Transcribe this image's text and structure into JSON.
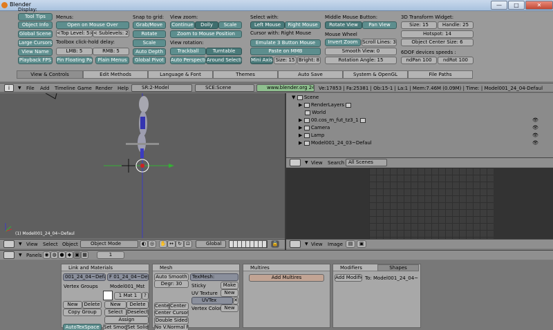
{
  "app": {
    "title": "Blender"
  },
  "window": {
    "min": "—",
    "max": "□",
    "close": "✕"
  },
  "prefs": {
    "display_label": "Display:",
    "display": [
      "Tool Tips",
      "Object Info",
      "Global Scene",
      "Large Cursors",
      "View Name",
      "Playback FPS"
    ],
    "menus_label": "Menus:",
    "open_on_mouse_over": "Open on Mouse Over",
    "top_level": "<Top Level: 5>",
    "sublevels": "< Sublevels: 2>",
    "toolbox_label": "Toolbox click-hold delay:",
    "lmb": "LMB: 5",
    "rmb": "RMB: 5",
    "pin_floating": "Pin Floating Pa",
    "plain_menus": "Plain Menus",
    "snap_label": "Snap to grid:",
    "snap": [
      "Grab/Move",
      "Rotate",
      "Scale"
    ],
    "auto_depth": "Auto Depth",
    "global_pivot": "Global Pivot",
    "view_zoom_label": "View zoom:",
    "zoom_modes": [
      "Continue",
      "Dolly",
      "Scale"
    ],
    "zoom_to_mouse": "Zoom to Mouse Position",
    "view_rotation_label": "View rotation:",
    "trackball": "Trackball",
    "turntable": "Turntable",
    "auto_perspective": "Auto Perspectiv",
    "around_selection": "Around Selectio",
    "select_with_label": "Select with:",
    "left_mouse": "Left Mouse",
    "right_mouse": "Right Mouse",
    "cursor_with": "Cursor with: Right Mouse",
    "emulate_3_button": "Emulate 3 Button Mouse",
    "paste_on_mmb": "Paste on MMB",
    "mini_axis": "Mini Axis",
    "size": "Size: 15",
    "bright": "Bright: 8",
    "mmb_label": "Middle Mouse Button:",
    "rotate_view": "Rotate View",
    "pan_view": "Pan View",
    "mouse_wheel_label": "Mouse Wheel",
    "invert_zoom": "Invert Zoom",
    "scroll_lines": "Scroll Lines: 3",
    "smooth_view": "Smooth View: 0",
    "rotation_angle": "Rotation Angle: 15",
    "transform_widget_label": "3D Transform Widget:",
    "widget_size": "Size: 15",
    "handle": "Handle: 25",
    "hotspot": "Hotspot: 14",
    "object_center_size": "Object Center Size: 6",
    "ndof_label": "6DOF devices speeds :",
    "ndpan": "ndPan 100",
    "ndrot": "ndRot 100",
    "tabs": [
      "View & Controls",
      "Edit Methods",
      "Language & Font",
      "Themes",
      "Auto Save",
      "System & OpenGL",
      "File Paths"
    ]
  },
  "header1": {
    "menu": [
      "File",
      "Add",
      "Timeline",
      "Game",
      "Render",
      "Help"
    ],
    "screen": "SR:2-Model",
    "scene": "SCE:Scene",
    "url": "www.blender.org 249.2",
    "stats": "Ve:17853 | Fa:25381 | Ob:15-1 | La:1 | Mem:7.46M (0.09M) | Time: | Model001_24_04-Defaul"
  },
  "viewport": {
    "object_name": "(1) Model001_24_04~Defaul",
    "menu": [
      "View",
      "Select",
      "Object"
    ],
    "mode": "Object Mode",
    "orientation": "Global"
  },
  "outliner": {
    "items": [
      "Scene",
      "RenderLayers",
      "World",
      "00.cos_m_fut_tz3_1",
      "Camera",
      "Lamp",
      "Model001_24_03~Defaul"
    ],
    "menu": [
      "View",
      "Search"
    ],
    "filter": "All Scenes"
  },
  "image_editor": {
    "menu": [
      "View",
      "Image"
    ]
  },
  "buttons": {
    "panels_label": "Panels",
    "frame": "1",
    "link_materials": {
      "title": "Link and Materials",
      "me_field": "001_24_04~Defaul",
      "ob_field": "F 01_24_04~Defaul",
      "vertex_groups": "Vertex Groups",
      "material_name": "Model001_Mst",
      "mat_count": "1 Mat 1",
      "q": "?",
      "new": "New",
      "delete": "Delete",
      "copy_group": "Copy Group",
      "new2": "New",
      "delete2": "Delete",
      "select": "Select",
      "deselect": "Deselect",
      "assign": "Assign",
      "autotexspace": "AutoTexSpace",
      "set_smooth": "Set Smoot",
      "set_solid": "Set Solid"
    },
    "mesh": {
      "title": "Mesh",
      "auto_smooth": "Auto Smooth",
      "degr": "Degr: 30",
      "texmesh": "TexMesh:",
      "sticky": "Sticky",
      "make": "Make",
      "uv_texture": "UV Texture",
      "new": "New",
      "uvtex": "UVTex",
      "vertex_color": "Vertex Color",
      "new2": "New",
      "center": "Center",
      "center_new": "Center Ne",
      "center_cursor": "Center Cursor",
      "double_sided": "Double Sided",
      "no_v_normal": "No V.Normal Flip"
    },
    "multires": {
      "title": "Multires",
      "add": "Add Multires"
    },
    "modifiers": {
      "tab1": "Modifiers",
      "tab2": "Shapes",
      "add": "Add Modifier",
      "to": "To: Model001_24_04~"
    }
  }
}
